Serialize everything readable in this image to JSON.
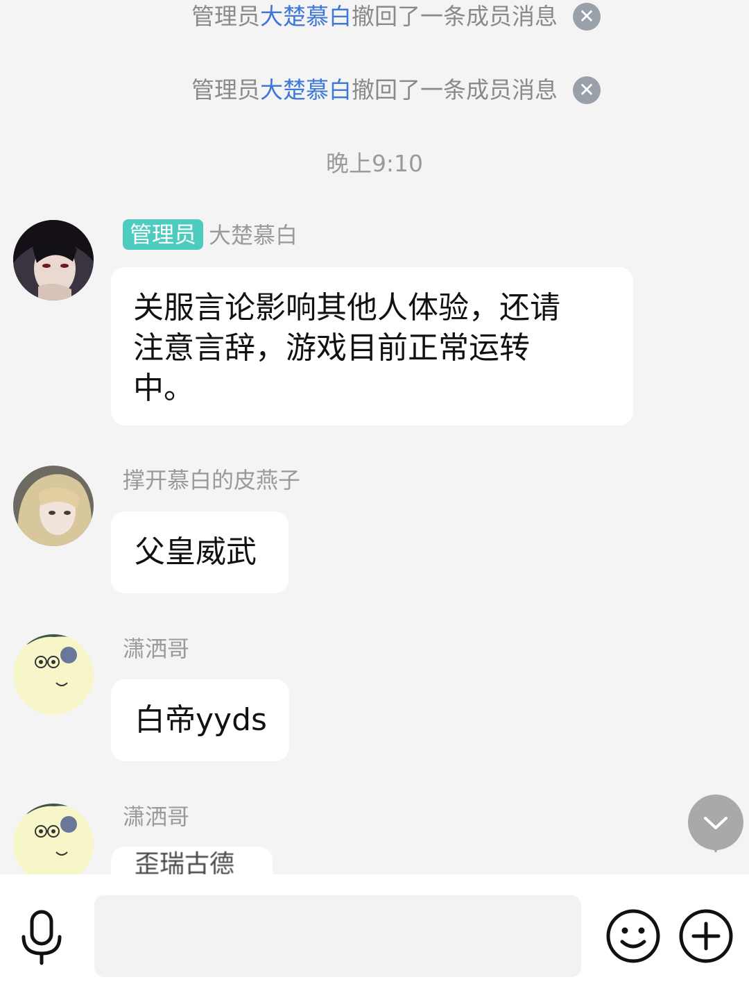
{
  "notices": [
    {
      "prefix": "管理员",
      "name": "大楚慕白",
      "suffix": "撤回了一条成员消息",
      "close_icon": "close-icon"
    },
    {
      "prefix": "管理员",
      "name": "大楚慕白",
      "suffix": "撤回了一条成员消息",
      "close_icon": "close-icon"
    }
  ],
  "timestamp": "晚上9:10",
  "messages": [
    {
      "badge": "管理员",
      "sender": "大楚慕白",
      "text": "关服言论影响其他人体验，还请注意言辞，游戏目前正常运转中。",
      "lines": [
        "关服言论影响其他人体验，还请",
        "注意言辞，游戏目前正常运转",
        "中。"
      ]
    },
    {
      "sender": "撑开慕白的皮燕子",
      "text": "父皇威武"
    },
    {
      "sender": "潇洒哥",
      "text": "白帝yyds"
    },
    {
      "sender": "潇洒哥",
      "text": "歪瑞古德"
    }
  ],
  "input": {
    "value": "",
    "placeholder": ""
  },
  "icons": {
    "voice": "microphone-icon",
    "emoji": "smiley-icon",
    "more": "plus-icon",
    "scroll": "chevron-down-icon"
  },
  "colors": {
    "background": "#f4f4f4",
    "admin_link": "#3f78d6",
    "badge": "#4dcbbf",
    "bubble": "#ffffff"
  }
}
